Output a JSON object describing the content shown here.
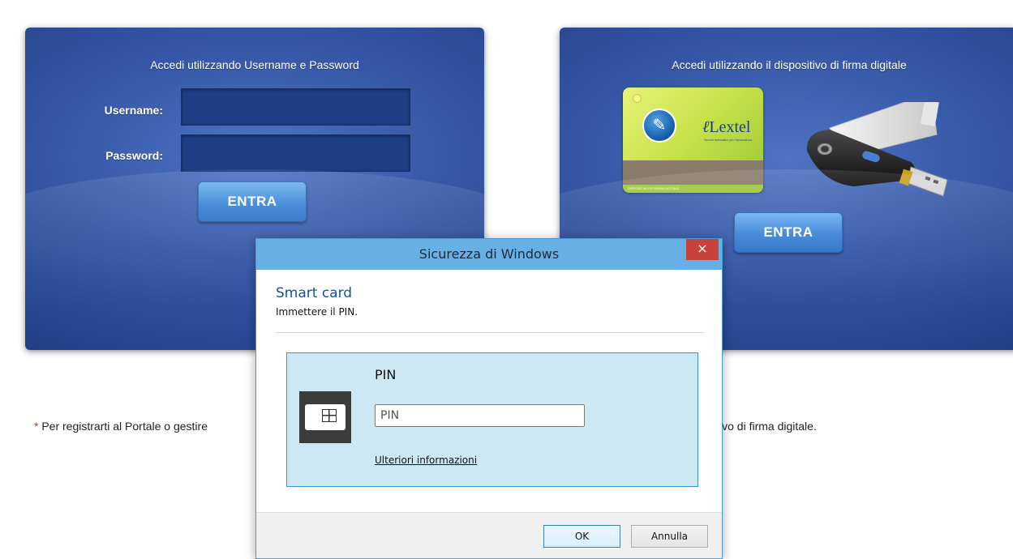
{
  "left_panel": {
    "title": "Accedi utilizzando Username e Password",
    "username_label": "Username:",
    "password_label": "Password:",
    "username_value": "",
    "password_value": "",
    "submit_label": "ENTRA"
  },
  "right_panel": {
    "title": "Accedi utilizzando il dispositivo di firma digitale",
    "card": {
      "brand": "Lextel",
      "brand_subtitle": "Servizi telematici per l'avvocatura",
      "caption": "DISPOSITIVO DI FIRMA DIGITALE"
    },
    "submit_label": "ENTRA"
  },
  "footnote": {
    "star": "*",
    "text_start": "Per registrarti al Portale o gestire",
    "text_end": "ivo di firma digitale."
  },
  "dialog": {
    "title": "Sicurezza di Windows",
    "close_label": "×",
    "heading": "Smart card",
    "subheading": "Immettere il PIN.",
    "pin_label": "PIN",
    "pin_placeholder": "PIN",
    "pin_value": "",
    "more_info_link": "Ulteriori informazioni",
    "ok_label": "OK",
    "cancel_label": "Annulla"
  },
  "colors": {
    "panel_blue": "#3659a8",
    "button_blue": "#3d86d8",
    "dialog_titlebar": "#67b0e6",
    "dialog_close": "#c8423a",
    "pin_box": "#cce8f4",
    "footnote_star": "#d9261c"
  }
}
